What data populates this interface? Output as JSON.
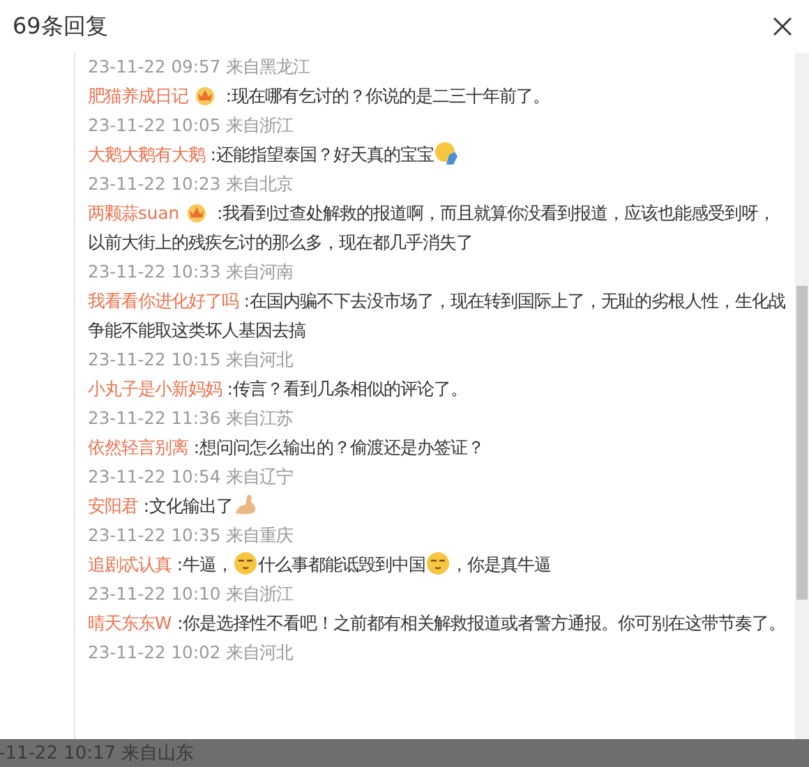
{
  "dialog": {
    "title": "69条回复"
  },
  "entries": [
    {
      "kind": "meta",
      "text": "23-11-22 09:57 来自黑龙江"
    },
    {
      "kind": "reply",
      "author": "肥猫养成日记",
      "badge": true,
      "segments": [
        {
          "kind": "text",
          "text": ":现在哪有乞讨的？你说的是二三十年前了。"
        }
      ]
    },
    {
      "kind": "meta",
      "text": "23-11-22 10:05 来自浙江"
    },
    {
      "kind": "reply",
      "author": "大鹅大鹅有大鹅",
      "badge": false,
      "segments": [
        {
          "kind": "text",
          "text": ":还能指望泰国？好天真的宝宝"
        },
        {
          "kind": "facepalm"
        }
      ]
    },
    {
      "kind": "meta",
      "text": "23-11-22 10:23 来自北京"
    },
    {
      "kind": "reply",
      "author": "两颗蒜suan",
      "badge": true,
      "segments": [
        {
          "kind": "text",
          "text": ":我看到过查处解救的报道啊，而且就算你没看到报道，应该也能感受到呀，以前大街上的残疾乞讨的那么多，现在都几乎消失了"
        }
      ]
    },
    {
      "kind": "meta",
      "text": "23-11-22 10:33 来自河南"
    },
    {
      "kind": "reply",
      "author": "我看看你进化好了吗",
      "badge": false,
      "segments": [
        {
          "kind": "text",
          "text": ":在国内骗不下去没市场了，现在转到国际上了，无耻的劣根人性，生化战争能不能取这类坏人基因去搞"
        }
      ]
    },
    {
      "kind": "meta",
      "text": "23-11-22 10:15 来自河北"
    },
    {
      "kind": "reply",
      "author": "小丸子是小新妈妈",
      "badge": false,
      "segments": [
        {
          "kind": "text",
          "text": ":传言？看到几条相似的评论了。"
        }
      ]
    },
    {
      "kind": "meta",
      "text": "23-11-22 11:36 来自江苏"
    },
    {
      "kind": "reply",
      "author": "依然轻言别离",
      "badge": false,
      "segments": [
        {
          "kind": "text",
          "text": ":想问问怎么输出的？偷渡还是办签证？"
        }
      ]
    },
    {
      "kind": "meta",
      "text": "23-11-22 10:54 来自辽宁"
    },
    {
      "kind": "reply",
      "author": "安阳君",
      "badge": false,
      "segments": [
        {
          "kind": "text",
          "text": ":文化输出了"
        },
        {
          "kind": "arm"
        }
      ]
    },
    {
      "kind": "meta",
      "text": "23-11-22 10:35 来自重庆"
    },
    {
      "kind": "reply",
      "author": "追剧忒认真",
      "badge": false,
      "segments": [
        {
          "kind": "text",
          "text": ":牛逼，"
        },
        {
          "kind": "smug"
        },
        {
          "kind": "text",
          "text": "什么事都能诋毁到中国"
        },
        {
          "kind": "smug"
        },
        {
          "kind": "text",
          "text": "，你是真牛逼"
        }
      ]
    },
    {
      "kind": "meta",
      "text": "23-11-22 10:10 来自浙江"
    },
    {
      "kind": "reply",
      "author": "晴天东东W",
      "badge": false,
      "segments": [
        {
          "kind": "text",
          "text": ":你是选择性不看吧！之前都有相关解救报道或者警方通报。你可别在这带节奏了。"
        }
      ]
    },
    {
      "kind": "meta",
      "text": "23-11-22 10:02 来自河北"
    }
  ],
  "background_text": "-11-22 10:17 来自山东"
}
